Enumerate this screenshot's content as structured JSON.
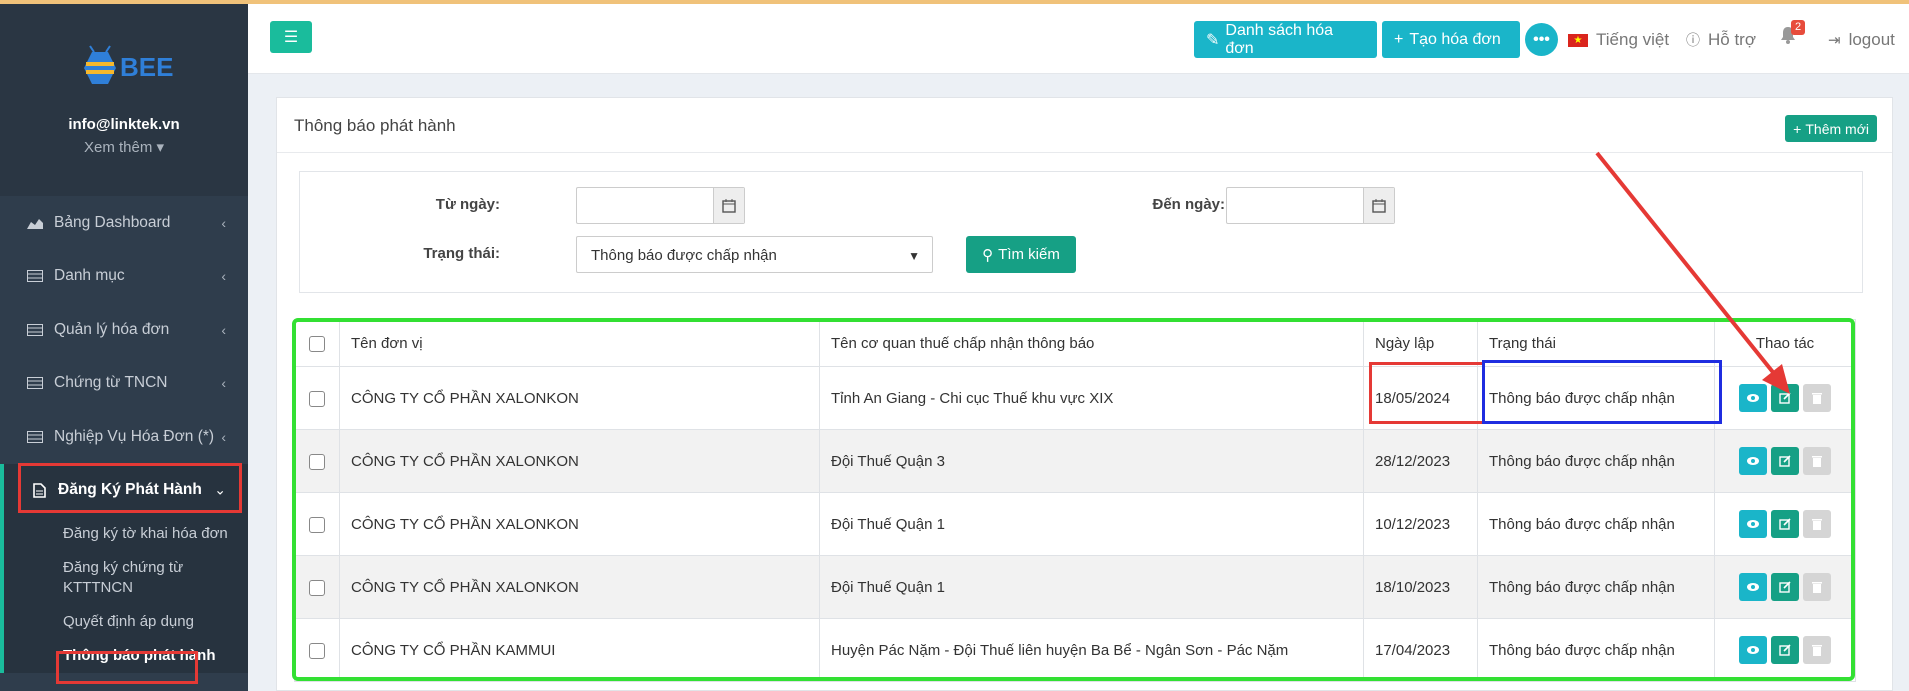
{
  "sidebar": {
    "logo_text": "BEE",
    "email": "info@linktek.vn",
    "more_label": "Xem thêm",
    "items": [
      {
        "label": "Bảng Dashboard"
      },
      {
        "label": "Danh mục"
      },
      {
        "label": "Quản lý hóa đơn"
      },
      {
        "label": "Chứng từ TNCN"
      },
      {
        "label": "Nghiệp Vụ Hóa Đơn (*)"
      },
      {
        "label": "Đăng Ký Phát Hành"
      }
    ],
    "submenu": [
      {
        "label": "Đăng ký tờ khai hóa đơn"
      },
      {
        "label": "Đăng ký chứng từ KTTTNCN"
      },
      {
        "label": "Quyết định áp dụng"
      },
      {
        "label": "Thông báo phát hành"
      }
    ]
  },
  "topbar": {
    "invoice_list": "Danh sách hóa đơn",
    "create_invoice": "Tạo hóa đơn",
    "more": "•••",
    "language": "Tiếng việt",
    "support": "Hỗ trợ",
    "notification_count": "2",
    "logout": "logout"
  },
  "panel": {
    "title": "Thông báo phát hành",
    "add_button": "Thêm mới"
  },
  "filter": {
    "from_label": "Từ ngày:",
    "to_label": "Đến ngày:",
    "status_label": "Trạng thái:",
    "status_value": "Thông báo được chấp nhận",
    "search_button": "Tìm kiếm"
  },
  "table": {
    "columns": [
      "Tên đơn vị",
      "Tên cơ quan thuế chấp nhận thông báo",
      "Ngày lập",
      "Trạng thái",
      "Thao tác"
    ],
    "rows": [
      {
        "unit": "CÔNG TY CỔ PHẦN XALONKON",
        "authority": "Tỉnh An Giang - Chi cục Thuế khu vực XIX",
        "date": "18/05/2024",
        "status": "Thông báo được chấp nhận"
      },
      {
        "unit": "CÔNG TY CỔ PHẦN XALONKON",
        "authority": "Đội Thuế Quận 3",
        "date": "28/12/2023",
        "status": "Thông báo được chấp nhận"
      },
      {
        "unit": "CÔNG TY CỔ PHẦN XALONKON",
        "authority": "Đội Thuế Quận 1",
        "date": "10/12/2023",
        "status": "Thông báo được chấp nhận"
      },
      {
        "unit": "CÔNG TY CỔ PHẦN XALONKON",
        "authority": "Đội Thuế Quận 1",
        "date": "18/10/2023",
        "status": "Thông báo được chấp nhận"
      },
      {
        "unit": "CÔNG TY CỔ PHẦN KAMMUI",
        "authority": "Huyện Pác Nặm - Đội Thuế liên huyện Ba Bể - Ngân Sơn - Pác Nặm",
        "date": "17/04/2023",
        "status": "Thông báo được chấp nhận"
      }
    ]
  },
  "colors": {
    "accent": "#1abc9c",
    "info": "#1ab5c9",
    "sidebar_bg": "#2f3d4c",
    "annotation_red": "#e53935",
    "annotation_green": "#33e033",
    "annotation_blue": "#1f2de0"
  }
}
